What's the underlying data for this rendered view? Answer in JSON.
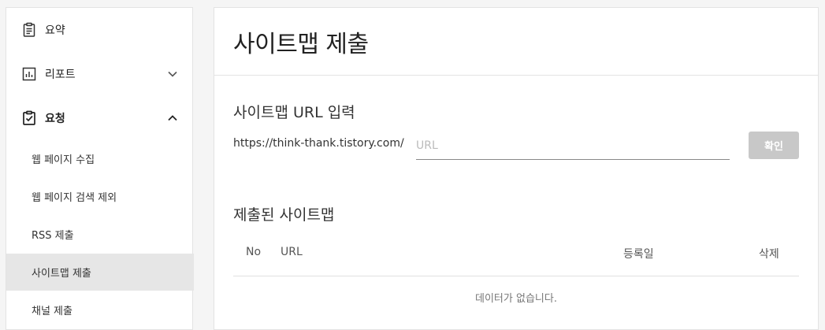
{
  "sidebar": {
    "items": [
      {
        "label": "요약",
        "icon": "clipboard-icon"
      },
      {
        "label": "리포트",
        "icon": "bar-chart-icon"
      },
      {
        "label": "요청",
        "icon": "clipboard-check-icon"
      }
    ],
    "sub_items": [
      {
        "label": "웹 페이지 수집"
      },
      {
        "label": "웹 페이지 검색 제외"
      },
      {
        "label": "RSS 제출"
      },
      {
        "label": "사이트맵 제출",
        "active": true
      },
      {
        "label": "채널 제출"
      }
    ]
  },
  "main": {
    "title": "사이트맵 제출",
    "input_section": {
      "title": "사이트맵 URL 입력",
      "url_prefix": "https://think-thank.tistory.com/",
      "placeholder": "URL",
      "value": "",
      "confirm_label": "확인"
    },
    "submitted_section": {
      "title": "제출된 사이트맵",
      "columns": [
        "No",
        "URL",
        "등록일",
        "삭제"
      ],
      "rows": [],
      "empty_message": "데이터가 없습니다."
    }
  },
  "colors": {
    "active_bg": "#e6e6e6",
    "button_disabled": "#c8c8c8",
    "page_bg": "#f5f5f5"
  }
}
